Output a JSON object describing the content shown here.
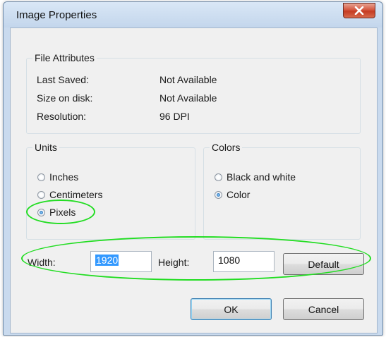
{
  "window": {
    "title": "Image Properties"
  },
  "file_attributes": {
    "legend": "File Attributes",
    "rows": [
      {
        "label": "Last Saved:",
        "value": "Not Available"
      },
      {
        "label": "Size on disk:",
        "value": "Not Available"
      },
      {
        "label": "Resolution:",
        "value": "96 DPI"
      }
    ]
  },
  "units": {
    "legend": "Units",
    "options": [
      {
        "label": "Inches",
        "checked": false
      },
      {
        "label": "Centimeters",
        "checked": false
      },
      {
        "label": "Pixels",
        "checked": true
      }
    ]
  },
  "colors": {
    "legend": "Colors",
    "options": [
      {
        "label": "Black and white",
        "checked": false
      },
      {
        "label": "Color",
        "checked": true
      }
    ]
  },
  "size": {
    "width_label": "Width:",
    "width_value": "1920",
    "height_label": "Height:",
    "height_value": "1080",
    "default_label": "Default"
  },
  "buttons": {
    "ok": "OK",
    "cancel": "Cancel"
  },
  "annotation_color": "#22dd22"
}
